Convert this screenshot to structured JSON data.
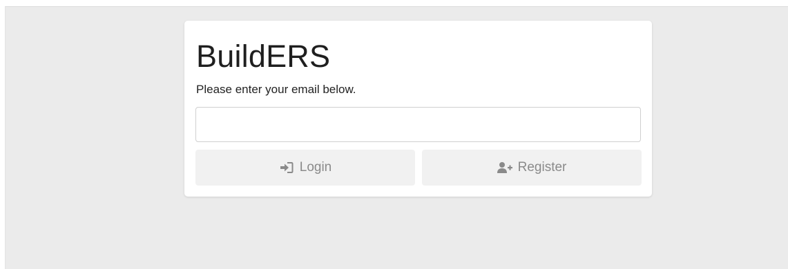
{
  "app": {
    "title": "BuildERS",
    "instructions": "Please enter your email below."
  },
  "email_field": {
    "value": "",
    "placeholder": ""
  },
  "actions": {
    "login_label": "Login",
    "login_icon": "sign-in-icon",
    "register_label": "Register",
    "register_icon": "user-plus-icon"
  },
  "colors": {
    "background": "#ebebeb",
    "card": "#ffffff",
    "button_bg": "#f1f1f1",
    "button_text": "#8a8a8a"
  }
}
